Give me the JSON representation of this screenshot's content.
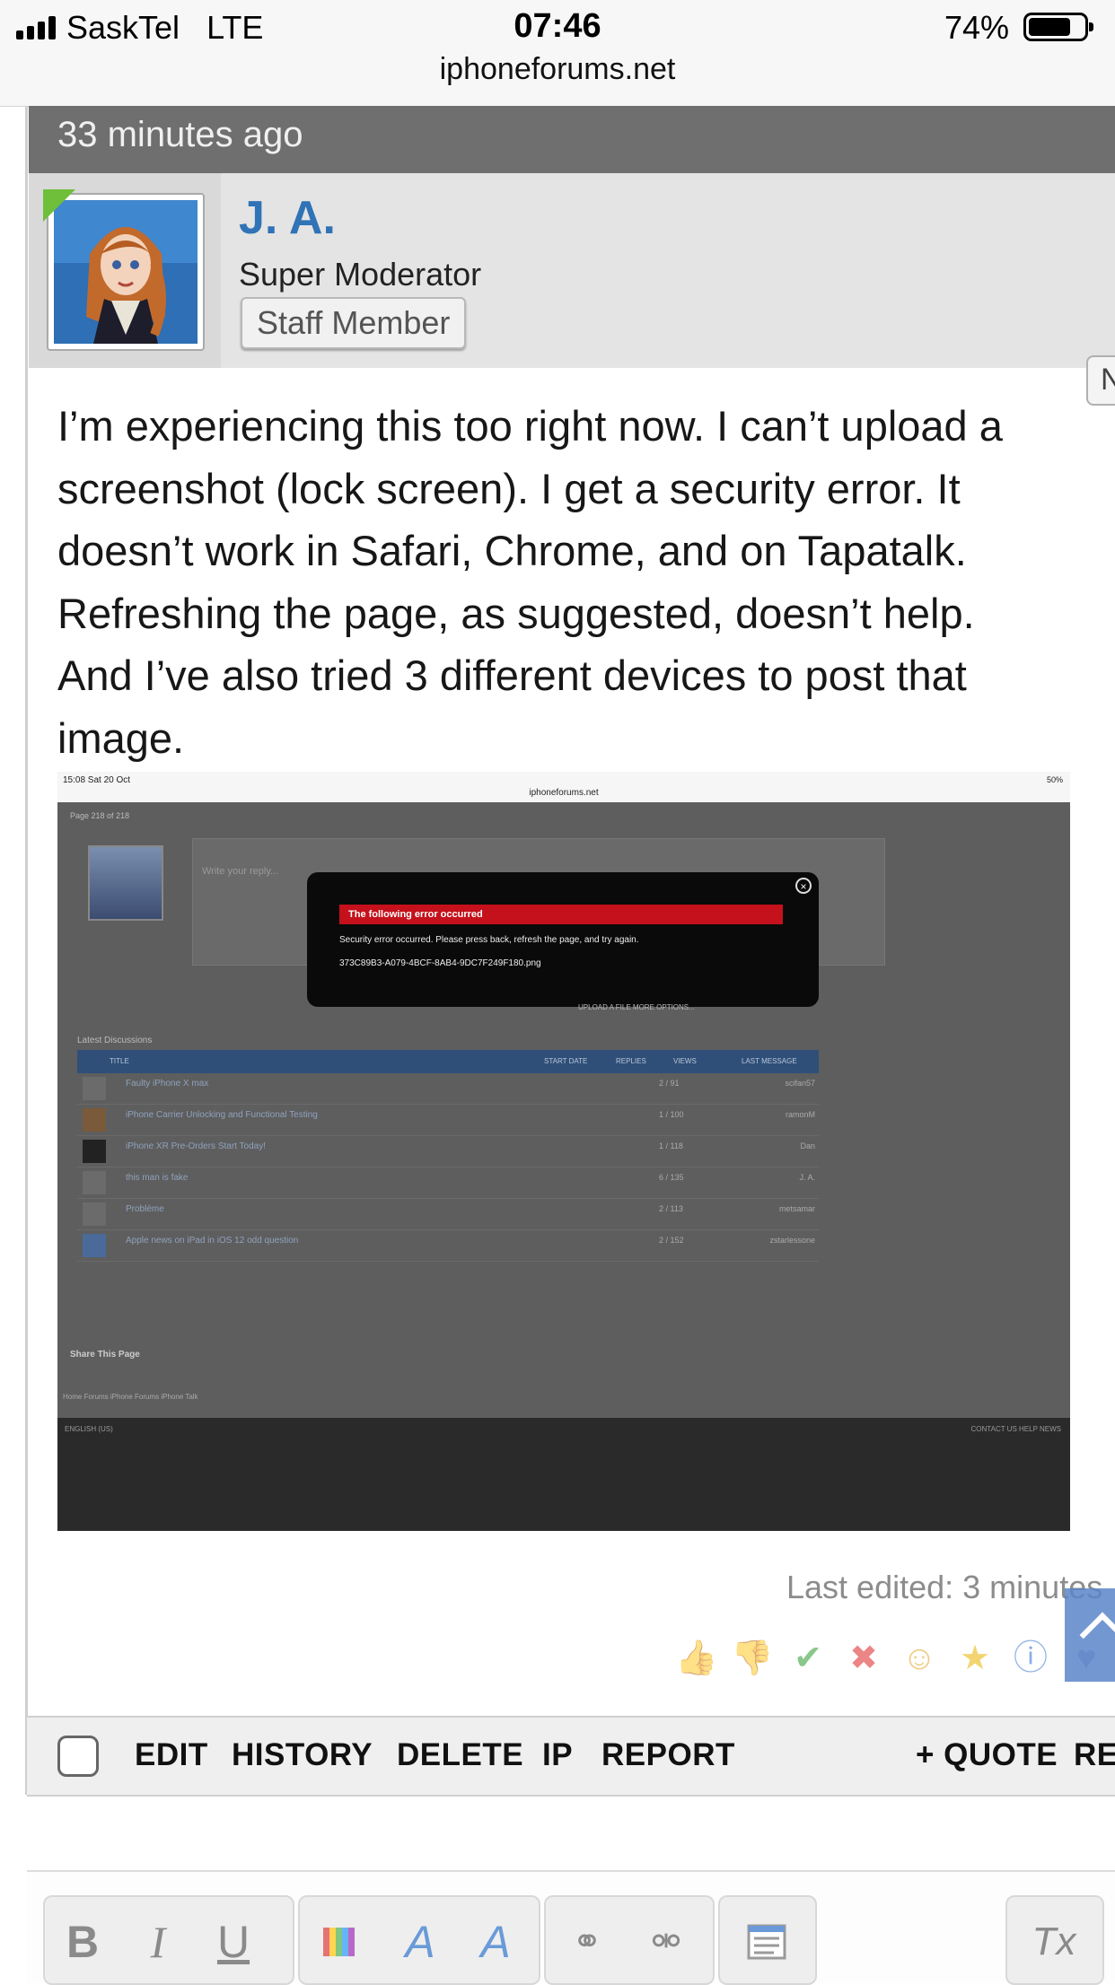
{
  "status_bar": {
    "carrier": "SaskTel",
    "network": "LTE",
    "time": "07:46",
    "battery": "74%",
    "url": "iphoneforums.net"
  },
  "post": {
    "timestamp": "33 minutes ago",
    "username": "J. A.",
    "user_title": "Super Moderator",
    "badge": "Staff Member",
    "side_tab": "N",
    "body_lines": [
      "I’m experiencing this too right now. I can’t upload a",
      "screenshot (lock screen). I get a security error. It",
      "doesn’t work in Safari, Chrome, and on Tapatalk.",
      "Refreshing the page, as suggested, doesn’t help.",
      "And I’ve also tried 3 different devices to post that",
      "image."
    ],
    "last_edited": "Last edited: 3 minutes"
  },
  "attachment": {
    "status_time": "15:08  Sat 20 Oct",
    "status_right": "50%",
    "url": "iphoneforums.net",
    "pager": "Page 218 of 218",
    "editor_placeholder": "Write your reply...",
    "error_title": "The following error occurred",
    "error_message": "Security error occurred. Please press back, refresh the page, and try again.",
    "error_file": "373C89B3-A079-4BCF-8AB4-9DC7F249F180.png",
    "upload_buttons": "UPLOAD A FILE    MORE OPTIONS...",
    "latest_label": "Latest Discussions",
    "columns": {
      "title": "TITLE",
      "start": "START DATE",
      "replies": "REPLIES",
      "views": "VIEWS",
      "last": "LAST MESSAGE"
    },
    "rows": [
      {
        "title": "Faulty iPhone X max",
        "stats": "2 / 91",
        "last": "scifan57"
      },
      {
        "title": "iPhone Carrier Unlocking and Functional Testing",
        "stats": "1 / 100",
        "last": "ramonM"
      },
      {
        "title": "iPhone XR Pre-Orders Start Today!",
        "stats": "1 / 118",
        "last": "Dan"
      },
      {
        "title": "this man is fake",
        "stats": "6 / 135",
        "last": "J. A."
      },
      {
        "title": "Problème",
        "stats": "2 / 113",
        "last": "metsamar"
      },
      {
        "title": "Apple news on iPad in iOS 12 odd question",
        "stats": "2 / 152",
        "last": "zstarlessone"
      }
    ],
    "share": "Share This Page",
    "crumbs": "Home    Forums    iPhone Forums    iPhone Talk",
    "footer_left": "ENGLISH (US)",
    "footer_right": "CONTACT US   HELP   NEWS"
  },
  "reactions": [
    "thumbs-up",
    "thumbs-down",
    "check",
    "cross",
    "smile",
    "star",
    "info",
    "heart"
  ],
  "actions": {
    "edit": "EDIT",
    "history": "HISTORY",
    "delete": "DELETE",
    "ip": "IP",
    "report": "REPORT",
    "quote": "+ QUOTE",
    "reply": "RE"
  },
  "editor_toolbar": {
    "bold": "B",
    "italic": "I",
    "underline": "U",
    "clear_format": "Tx"
  }
}
